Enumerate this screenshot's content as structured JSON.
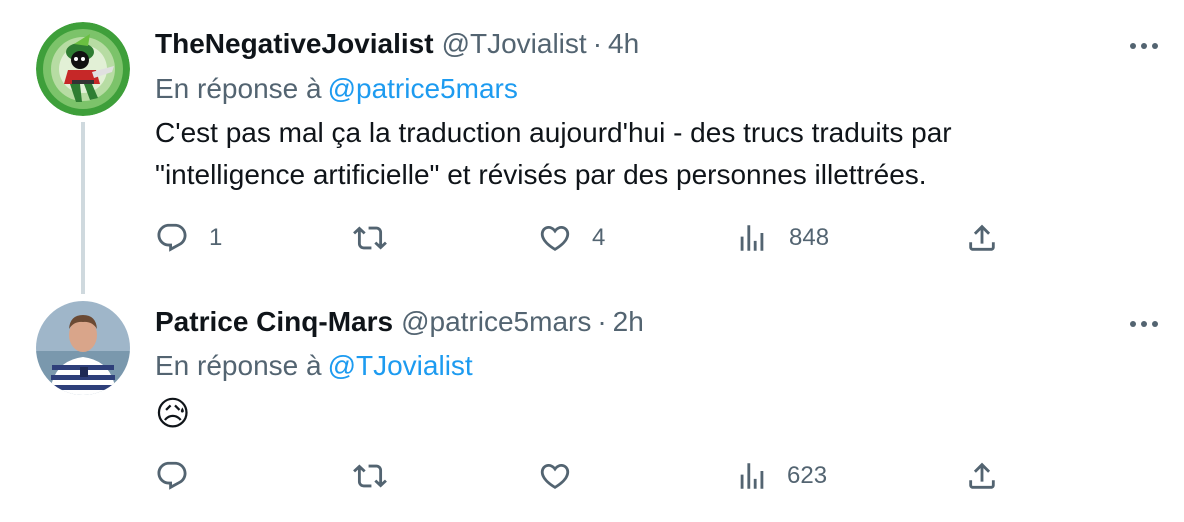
{
  "tweets": [
    {
      "display_name": "TheNegativeJovialist",
      "handle": "@TJovialist",
      "separator": "·",
      "time": "4h",
      "reply_prefix": "En réponse à",
      "reply_mention": "@patrice5mars",
      "text_line_1": "C'est pas mal ça la traduction aujourd'hui - des trucs traduits par",
      "text_line_2": "\"intelligence artificielle\" et révisés par des personnes illettrées.",
      "reply_count": "1",
      "retweet_count": "",
      "like_count": "4",
      "view_count": "848"
    },
    {
      "display_name": "Patrice Cinq-Mars",
      "handle": "@patrice5mars",
      "separator": "·",
      "time": "2h",
      "reply_prefix": "En réponse à",
      "reply_mention": "@TJovialist",
      "emoji": "😥",
      "reply_count": "",
      "retweet_count": "",
      "like_count": "",
      "view_count": "623"
    }
  ],
  "icons": {
    "reply": "reply-icon",
    "retweet": "retweet-icon",
    "like": "heart-icon",
    "views": "analytics-icon",
    "share": "share-icon",
    "more": "more-icon"
  },
  "colors": {
    "text": "#0f1419",
    "secondary": "#536471",
    "link": "#1d9bf0",
    "thread_line": "#cfd9de"
  }
}
